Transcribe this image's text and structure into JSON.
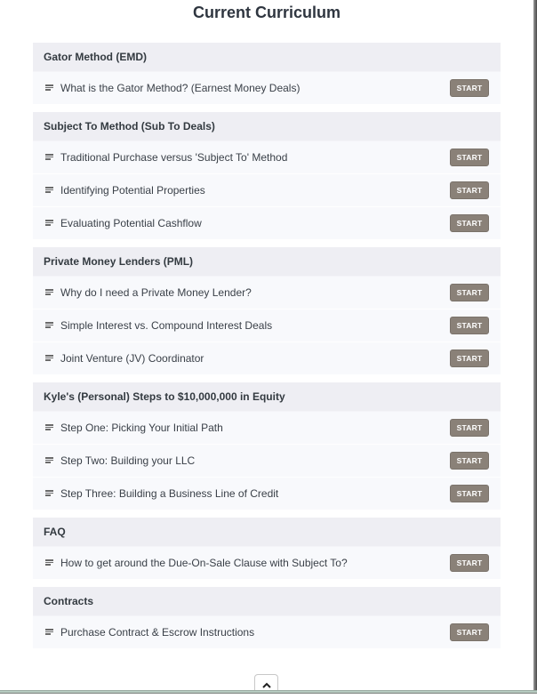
{
  "page": {
    "title": "Current Curriculum"
  },
  "sections": [
    {
      "title": "Gator Method (EMD)",
      "items": [
        {
          "label": "What is the Gator Method? (Earnest Money Deals)",
          "button": "START"
        }
      ]
    },
    {
      "title": "Subject To Method (Sub To Deals)",
      "items": [
        {
          "label": "Traditional Purchase versus 'Subject To' Method",
          "button": "START"
        },
        {
          "label": "Identifying Potential Properties",
          "button": "START"
        },
        {
          "label": "Evaluating Potential Cashflow",
          "button": "START"
        }
      ]
    },
    {
      "title": "Private Money Lenders (PML)",
      "items": [
        {
          "label": "Why do I need a Private Money Lender?",
          "button": "START"
        },
        {
          "label": "Simple Interest vs. Compound Interest Deals",
          "button": "START"
        },
        {
          "label": "Joint Venture (JV) Coordinator",
          "button": "START"
        }
      ]
    },
    {
      "title": "Kyle's (Personal) Steps to $10,000,000 in Equity",
      "items": [
        {
          "label": "Step One: Picking Your Initial Path",
          "button": "START"
        },
        {
          "label": "Step Two: Building your LLC",
          "button": "START"
        },
        {
          "label": "Step Three: Building a Business Line of Credit",
          "button": "START"
        }
      ]
    },
    {
      "title": "FAQ",
      "items": [
        {
          "label": "How to get around the Due-On-Sale Clause with Subject To?",
          "button": "START"
        }
      ]
    },
    {
      "title": "Contracts",
      "items": [
        {
          "label": "Purchase Contract & Escrow Instructions",
          "button": "START"
        }
      ]
    }
  ],
  "icons": {
    "item_icon": "text-lines-icon",
    "scroll_top_icon": "chevron-up-icon"
  },
  "colors": {
    "section_header_bg": "#eeeef3",
    "item_bg": "#f8f9fc",
    "button_bg": "#8a8178",
    "title_text": "#2f3640"
  }
}
